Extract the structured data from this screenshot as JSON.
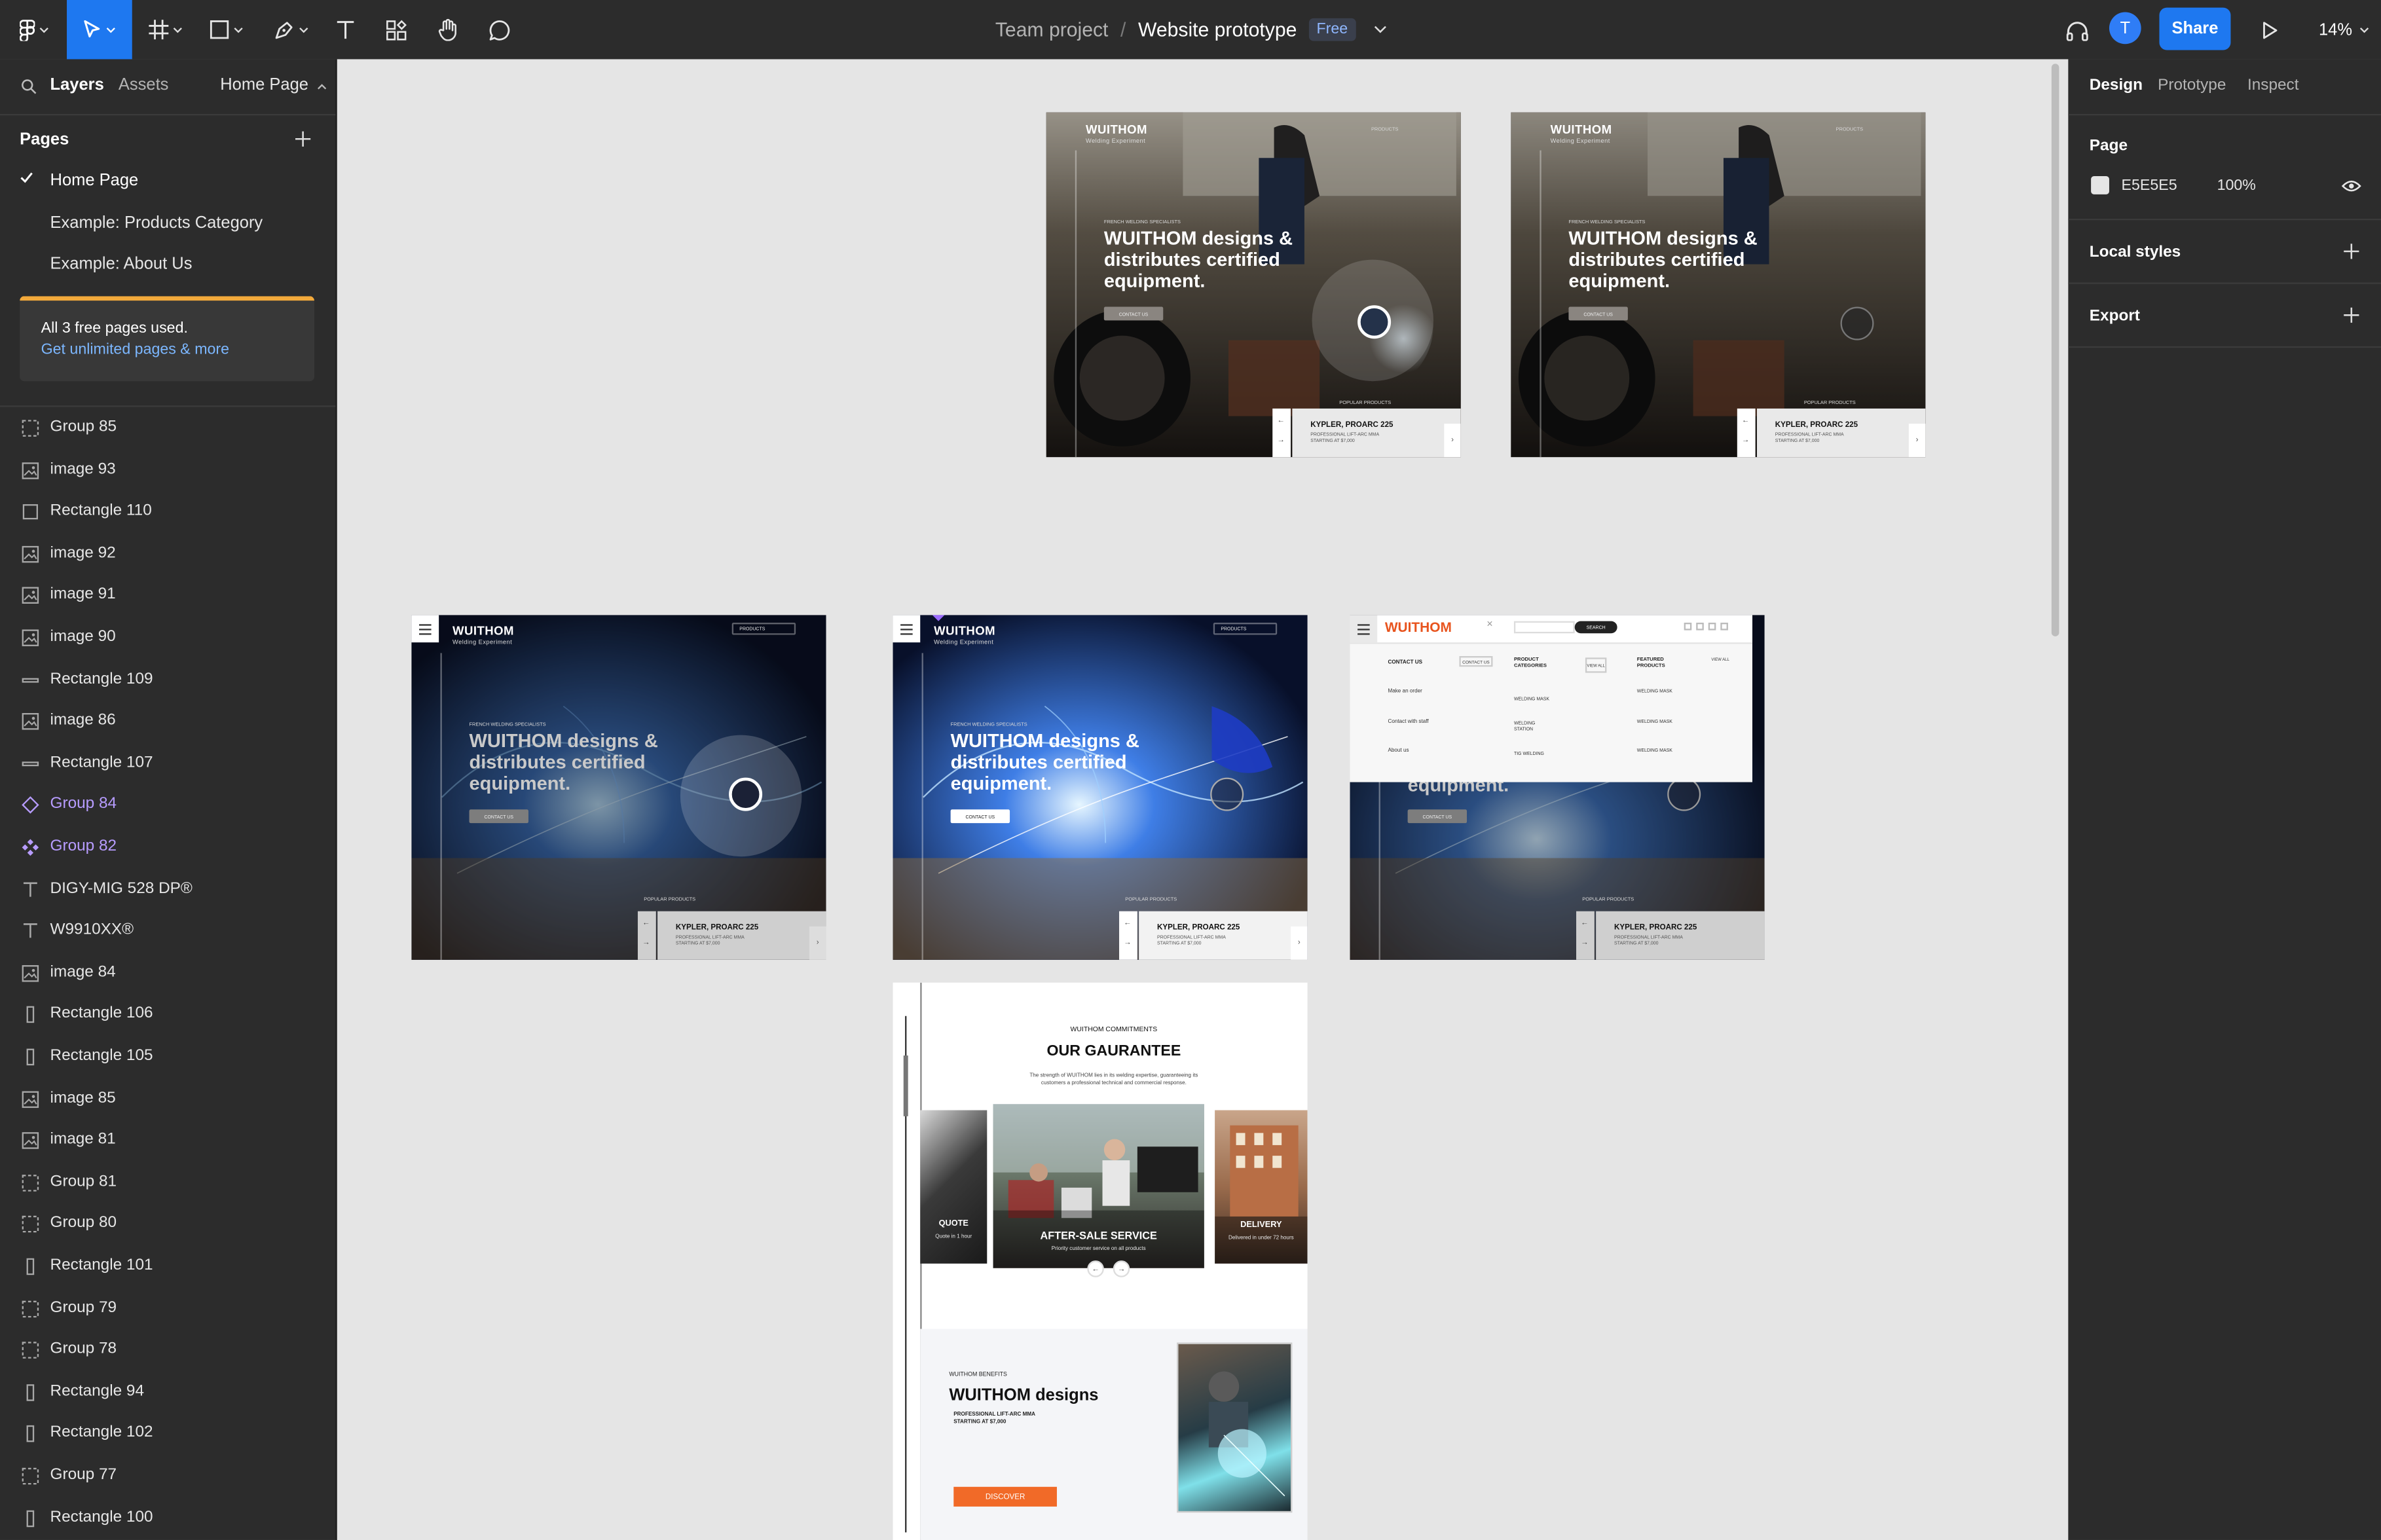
{
  "toolbar": {
    "breadcrumb_team": "Team project",
    "breadcrumb_sep": "/",
    "file_name": "Website prototype",
    "plan_badge": "Free",
    "avatar_initial": "T",
    "share_label": "Share",
    "zoom": "14%"
  },
  "left_panel": {
    "tabs": {
      "layers": "Layers",
      "assets": "Assets",
      "page_selector": "Home Page"
    },
    "pages_header": "Pages",
    "pages": [
      "Home Page",
      "Example: Products Category",
      "Example: About Us"
    ],
    "banner": {
      "line1": "All 3 free pages used.",
      "link": "Get unlimited pages & more"
    },
    "layers": [
      {
        "name": "Group 85",
        "icon": "group-icon"
      },
      {
        "name": "image 93",
        "icon": "image-icon"
      },
      {
        "name": "Rectangle 110",
        "icon": "rectangle-icon"
      },
      {
        "name": "image 92",
        "icon": "image-icon"
      },
      {
        "name": "image 91",
        "icon": "image-icon"
      },
      {
        "name": "image 90",
        "icon": "image-icon"
      },
      {
        "name": "Rectangle 109",
        "icon": "rectangle-thin-icon"
      },
      {
        "name": "image 86",
        "icon": "image-icon"
      },
      {
        "name": "Rectangle 107",
        "icon": "rectangle-thin-icon"
      },
      {
        "name": "Group 84",
        "icon": "instance-icon"
      },
      {
        "name": "Group 82",
        "icon": "component-icon"
      },
      {
        "name": "DIGY-MIG 528 DP®",
        "icon": "text-icon"
      },
      {
        "name": "W9910XX®",
        "icon": "text-icon"
      },
      {
        "name": "image 84",
        "icon": "image-icon"
      },
      {
        "name": "Rectangle 106",
        "icon": "rectangle-tall-icon"
      },
      {
        "name": "Rectangle 105",
        "icon": "rectangle-tall-icon"
      },
      {
        "name": "image 85",
        "icon": "image-icon"
      },
      {
        "name": "image 81",
        "icon": "image-icon"
      },
      {
        "name": "Group 81",
        "icon": "group-icon"
      },
      {
        "name": "Group 80",
        "icon": "group-icon"
      },
      {
        "name": "Rectangle 101",
        "icon": "rectangle-tall-icon"
      },
      {
        "name": "Group 79",
        "icon": "group-icon"
      },
      {
        "name": "Group 78",
        "icon": "group-icon"
      },
      {
        "name": "Rectangle 94",
        "icon": "rectangle-tall-icon"
      },
      {
        "name": "Rectangle 102",
        "icon": "rectangle-tall-icon"
      },
      {
        "name": "Group 77",
        "icon": "group-icon"
      },
      {
        "name": "Rectangle 100",
        "icon": "rectangle-tall-icon"
      }
    ]
  },
  "right_panel": {
    "tabs": [
      "Design",
      "Prototype",
      "Inspect"
    ],
    "page_section": "Page",
    "page_color": "E5E5E5",
    "page_opacity": "100%",
    "local_styles": "Local styles",
    "export": "Export"
  },
  "canvas": {
    "hero": {
      "line1": "WUITHOM designs &",
      "line2": "distributes certified",
      "line3": "equipment.",
      "logo": "WUITHOM",
      "logo_sub": "Welding Experiment",
      "nav_products": "PRODUCTS",
      "kicker": "FRENCH WELDING SPECIALISTS",
      "cta": "CONTACT US",
      "popular": "POPULAR PRODUCTS",
      "card_title": "KYPLER, PROARC 225",
      "card_sub1": "PROFESSIONAL LIFT-ARC MMA",
      "card_sub2": "STARTING AT $7,000",
      "comment_tag": "Gr"
    },
    "menu": {
      "logo": "WUITHOM",
      "search": "SEARCH",
      "col1": [
        "CONTACT US",
        "Make an order",
        "Contact with staff",
        "About us"
      ],
      "contact_btn": "CONTACT US",
      "col2_head": "PRODUCT CATEGORIES",
      "col2": [
        "WELDING MASK",
        "WELDING STATION",
        "TIG WELDING"
      ],
      "view_all": "VIEW ALL",
      "col3_head": "FEATURED PRODUCTS",
      "col3": [
        "WELDING MASK",
        "WELDING MASK",
        "WELDING MASK"
      ],
      "view_all2": "VIEW ALL"
    },
    "long_page": {
      "kicker": "WUITHOM COMMITMENTS",
      "title": "OUR GAURANTEE",
      "intro1": "The strength of WUITHOM lies in its welding expertise, guaranteeing its",
      "intro2": "customers a professional technical and commercial response.",
      "quote_title": "QUOTE",
      "quote_sub": "Quote in 1 hour",
      "after_title": "AFTER-SALE SERVICE",
      "after_sub": "Priority customer service on all products",
      "delivery_title": "DELIVERY",
      "delivery_sub": "Delivered in under 72 hours",
      "benefits_kicker": "WUITHOM BENEFITS",
      "benefits_title": "WUITHOM designs",
      "benefits_sub1": "PROFESSIONAL LIFT-ARC MMA",
      "benefits_sub2": "STARTING AT $7,000",
      "discover": "DISCOVER"
    }
  }
}
